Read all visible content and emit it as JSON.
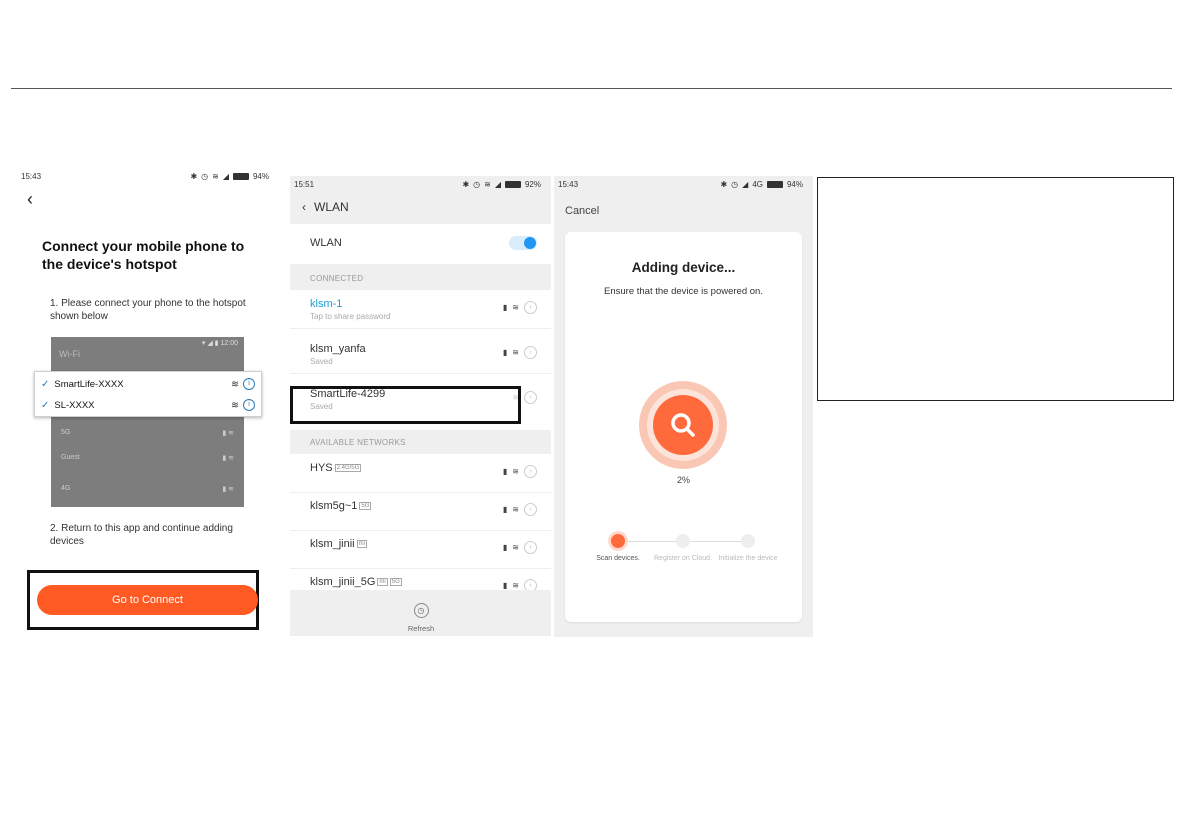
{
  "panel1": {
    "status": {
      "time": "15:43",
      "battery": "94%"
    },
    "title": "Connect your mobile phone to the device's hotspot",
    "step1": "1. Please connect your phone to the hotspot shown below",
    "wifi_screenshot": {
      "header": "Wi-Fi",
      "time": "12:00",
      "networks": [
        "SmartLife-XXXX",
        "SL-XXXX"
      ],
      "other_networks": [
        "5G",
        "Guest",
        "4G"
      ]
    },
    "step2": "2. Return to this app and continue adding devices",
    "button": "Go to Connect"
  },
  "panel2": {
    "status": {
      "time": "15:51",
      "battery": "92%"
    },
    "title": "WLAN",
    "toggle_label": "WLAN",
    "toggle_on": true,
    "connected_label": "CONNECTED",
    "connected": [
      {
        "name": "klsm-1",
        "sub": "Tap to share password",
        "accent": true
      },
      {
        "name": "klsm_yanfa",
        "sub": "Saved"
      },
      {
        "name": "SmartLife-4299",
        "sub": "Saved",
        "highlight": true
      }
    ],
    "available_label": "AVAILABLE NETWORKS",
    "available": [
      {
        "name": "HYS",
        "tag": "2.4G/5G"
      },
      {
        "name": "klsm5g~1",
        "tag": "5G"
      },
      {
        "name": "klsm_jinii",
        "tag": "mi"
      },
      {
        "name": "klsm_jinii_5G",
        "tag": "mi",
        "tag2": "5G"
      }
    ],
    "refresh": "Refresh"
  },
  "panel3": {
    "status": {
      "time": "15:43",
      "network": "4G",
      "battery": "94%"
    },
    "cancel": "Cancel",
    "title": "Adding device...",
    "subtitle": "Ensure that the device is powered on.",
    "progress": "2%",
    "progress_value": 0.02,
    "steps": [
      "Scan devices.",
      "Register on Cloud.",
      "Initialize the device"
    ]
  },
  "colors": {
    "accent": "#ff5a23",
    "link": "#1a9fd8",
    "toggle": "#2196f3"
  }
}
